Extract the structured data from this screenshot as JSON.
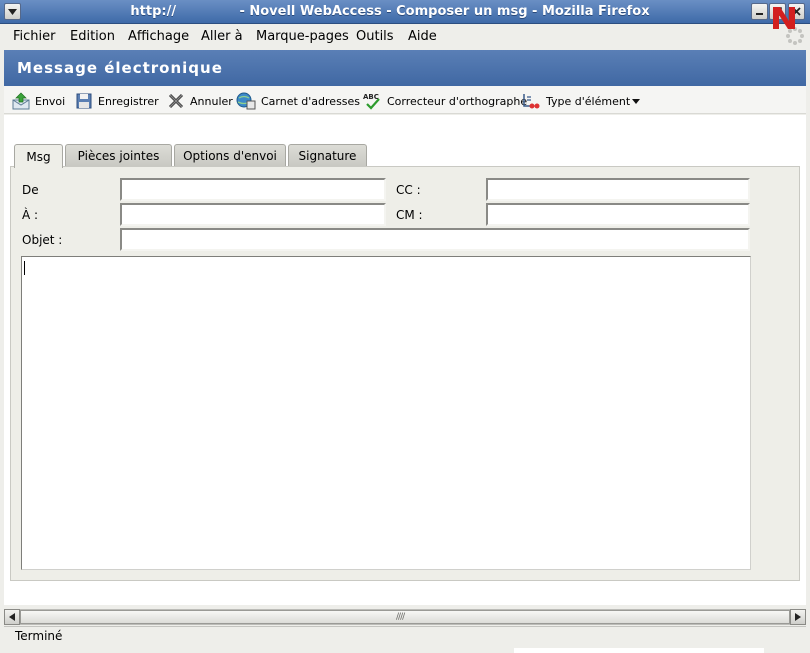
{
  "window": {
    "title": "http://              - Novell WebAccess - Composer un msg - Mozilla Firefox"
  },
  "menubar": {
    "items": [
      "Fichier",
      "Edition",
      "Affichage",
      "Aller à",
      "Marque-pages",
      "Outils",
      "Aide"
    ]
  },
  "app_header": {
    "title": "Message électronique",
    "logo": "N"
  },
  "toolbar": {
    "send": "Envoi",
    "save": "Enregistrer",
    "cancel": "Annuler",
    "address_book": "Carnet d'adresses",
    "spell_check": "Correcteur d'orthographe",
    "item_type": "Type d'élément"
  },
  "tabs": {
    "items": [
      "Msg",
      "Pièces jointes",
      "Options d'envoi",
      "Signature"
    ],
    "active": "Msg"
  },
  "form": {
    "from_label": "De",
    "to_label": "À :",
    "subject_label": "Objet :",
    "cc_label": "CC :",
    "bc_label": "CM :",
    "from_value": "",
    "to_value": "",
    "subject_value": "",
    "cc_value": "",
    "bc_value": "",
    "body_value": ""
  },
  "status": {
    "text": "Terminé"
  },
  "colors": {
    "titlebar": "#4a74b0",
    "app_header": "#4d72aa",
    "novell_red": "#d21f1f"
  },
  "icons": [
    "send-icon",
    "save-icon",
    "cancel-icon",
    "address-book-icon",
    "spell-check-icon",
    "item-type-icon"
  ]
}
